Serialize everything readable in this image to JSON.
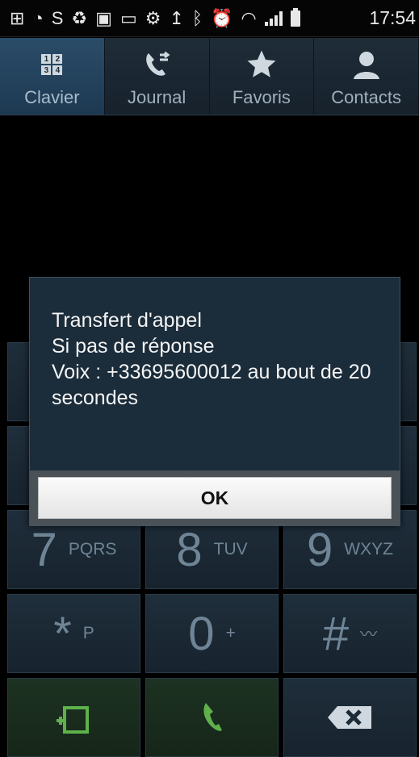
{
  "status_bar": {
    "time": "17:54",
    "icons": [
      "add-icon",
      "wifi-hotspot-icon",
      "s-icon",
      "recycle-icon",
      "facebook-icon",
      "voicemail-icon",
      "settings-icon",
      "upload-icon",
      "bluetooth-icon",
      "alarm-icon",
      "wifi-icon",
      "signal-icon",
      "battery-icon"
    ]
  },
  "tabs": [
    {
      "label": "Clavier",
      "icon": "keypad-icon",
      "active": true
    },
    {
      "label": "Journal",
      "icon": "call-log-icon",
      "active": false
    },
    {
      "label": "Favoris",
      "icon": "star-icon",
      "active": false
    },
    {
      "label": "Contacts",
      "icon": "person-icon",
      "active": false
    }
  ],
  "keypad": {
    "keys": [
      {
        "digit": "7",
        "letters": "PQRS"
      },
      {
        "digit": "8",
        "letters": "TUV"
      },
      {
        "digit": "9",
        "letters": "WXYZ"
      },
      {
        "digit": "*",
        "letters": "P"
      },
      {
        "digit": "0",
        "letters": "+"
      },
      {
        "digit": "#",
        "letters": ""
      }
    ]
  },
  "dialog": {
    "lines": [
      "Transfert d'appel",
      "Si pas de réponse",
      "Voix : +33695600012 au bout de 20 secondes"
    ],
    "ok_label": "OK"
  },
  "colors": {
    "dialog_bg": "#1b2c3a",
    "tab_active": "#2b4c68",
    "key_bg": "#1f2e3b"
  }
}
